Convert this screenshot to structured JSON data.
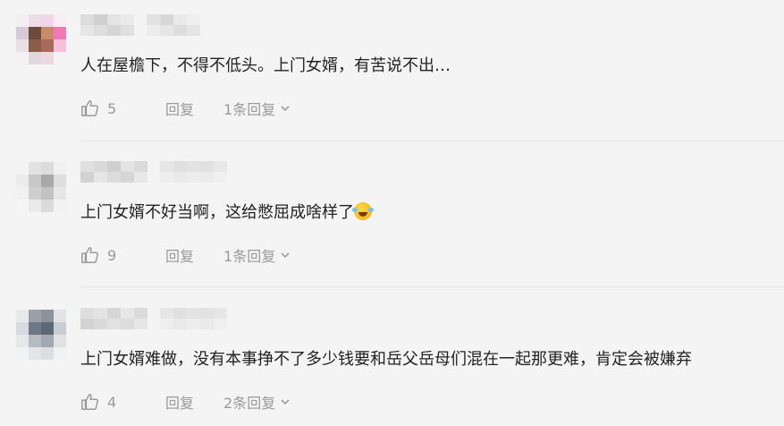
{
  "comments": [
    {
      "text": "人在屋檐下，不得不低头。上门女婿，有苦说不出…",
      "likes": "5",
      "reply_label": "回复",
      "more_replies_label": "1条回复"
    },
    {
      "text": "上门女婿不好当啊，这给憋屈成啥样了",
      "emoji": "laughing-crying-emoji",
      "likes": "9",
      "reply_label": "回复",
      "more_replies_label": "1条回复"
    },
    {
      "text": "上门女婿难做，没有本事挣不了多少钱要和岳父岳母们混在一起那更难，肯定会被嫌弃",
      "likes": "4",
      "reply_label": "回复",
      "more_replies_label": "2条回复"
    }
  ],
  "icons": {
    "like": "thumbs-up-icon",
    "expand": "chevron-down-icon"
  },
  "colors": {
    "background": "#f4f4f4",
    "text": "#222222",
    "meta": "#999999",
    "divider": "#e5e5e5"
  }
}
